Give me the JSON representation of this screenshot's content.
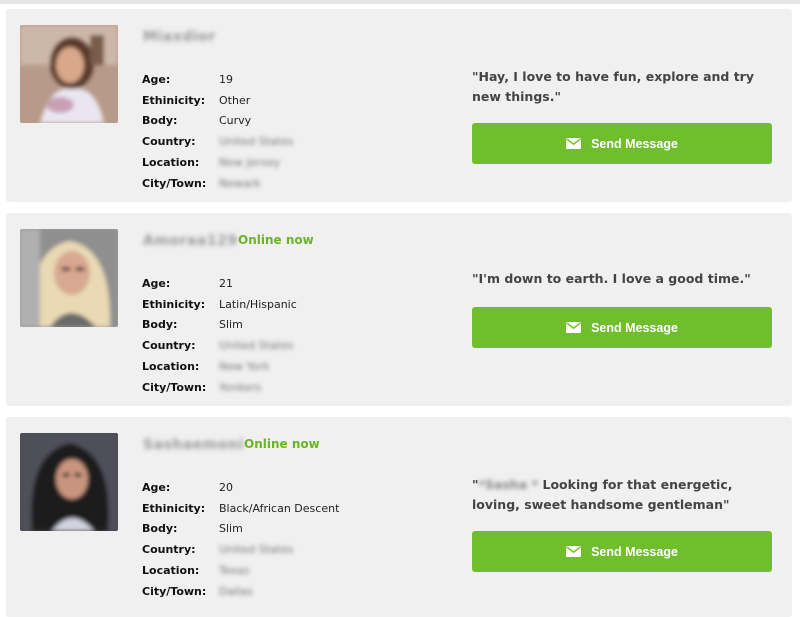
{
  "colors": {
    "accent": "#70be2c",
    "card_bg": "#f0f0f0",
    "online": "#6ab42a"
  },
  "profiles": [
    {
      "username": "Miaxdior",
      "online": "",
      "age": "19",
      "ethnicity": "Other",
      "body": "Curvy",
      "country": "United States",
      "location": "New Jersey",
      "city": "Newark",
      "quote": "\"Hay, I love to have fun, explore and try new things.\"",
      "button": "Send Message"
    },
    {
      "username": "Amoraa129",
      "online": "Online now",
      "age": "21",
      "ethnicity": "Latin/Hispanic",
      "body": "Slim",
      "country": "United States",
      "location": "New York",
      "city": "Yonkers",
      "quote": "\"I'm down to earth. I love a good time.\"",
      "button": "Send Message"
    },
    {
      "username": "Sashaemoni",
      "online": "Online now",
      "age": "20",
      "ethnicity": "Black/African Descent",
      "body": "Slim",
      "country": "United States",
      "location": "Texas",
      "city": "Dallas",
      "quote_open": "\"",
      "quote_name": "*Sasha *",
      "quote_rest": " Looking for that energetic, loving, sweet handsome gentleman\"",
      "button": "Send Message"
    }
  ],
  "labels": {
    "age": "Age:",
    "ethnicity": "Ethinicity:",
    "body": "Body:",
    "country": "Country:",
    "location": "Location:",
    "city": "City/Town:"
  },
  "icons": {
    "avatar": "profile-photo",
    "button": "envelope-icon"
  }
}
